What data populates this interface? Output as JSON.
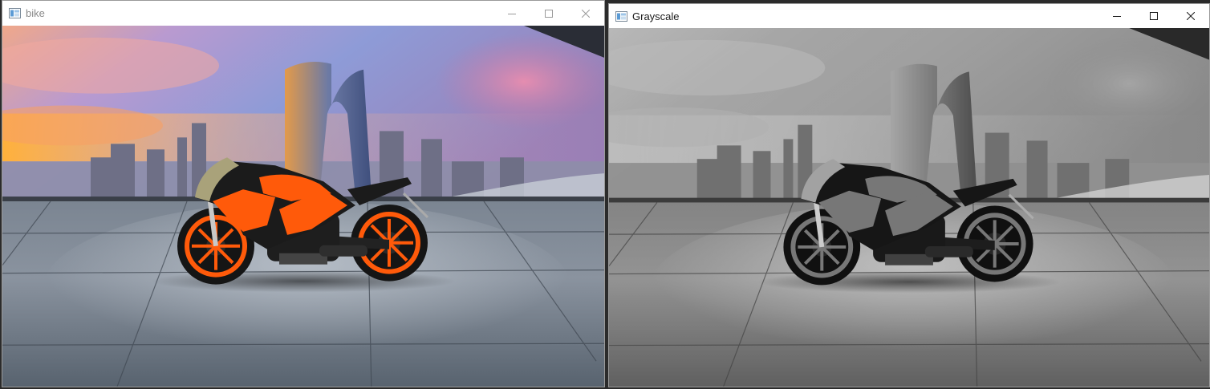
{
  "windows": [
    {
      "title": "bike",
      "image": {
        "mode": "color"
      }
    },
    {
      "title": "Grayscale",
      "image": {
        "mode": "grayscale"
      }
    }
  ],
  "icons": {
    "app": "opencv-window-icon",
    "minimize": "minimize-icon",
    "maximize": "maximize-icon",
    "close": "close-icon"
  },
  "colors": {
    "bike_body": "#ff5a0a",
    "bike_dark": "#1b1b1b",
    "sky_top": "#7e8fcf",
    "sunset": "#ffb347",
    "floor": "#77808a"
  }
}
